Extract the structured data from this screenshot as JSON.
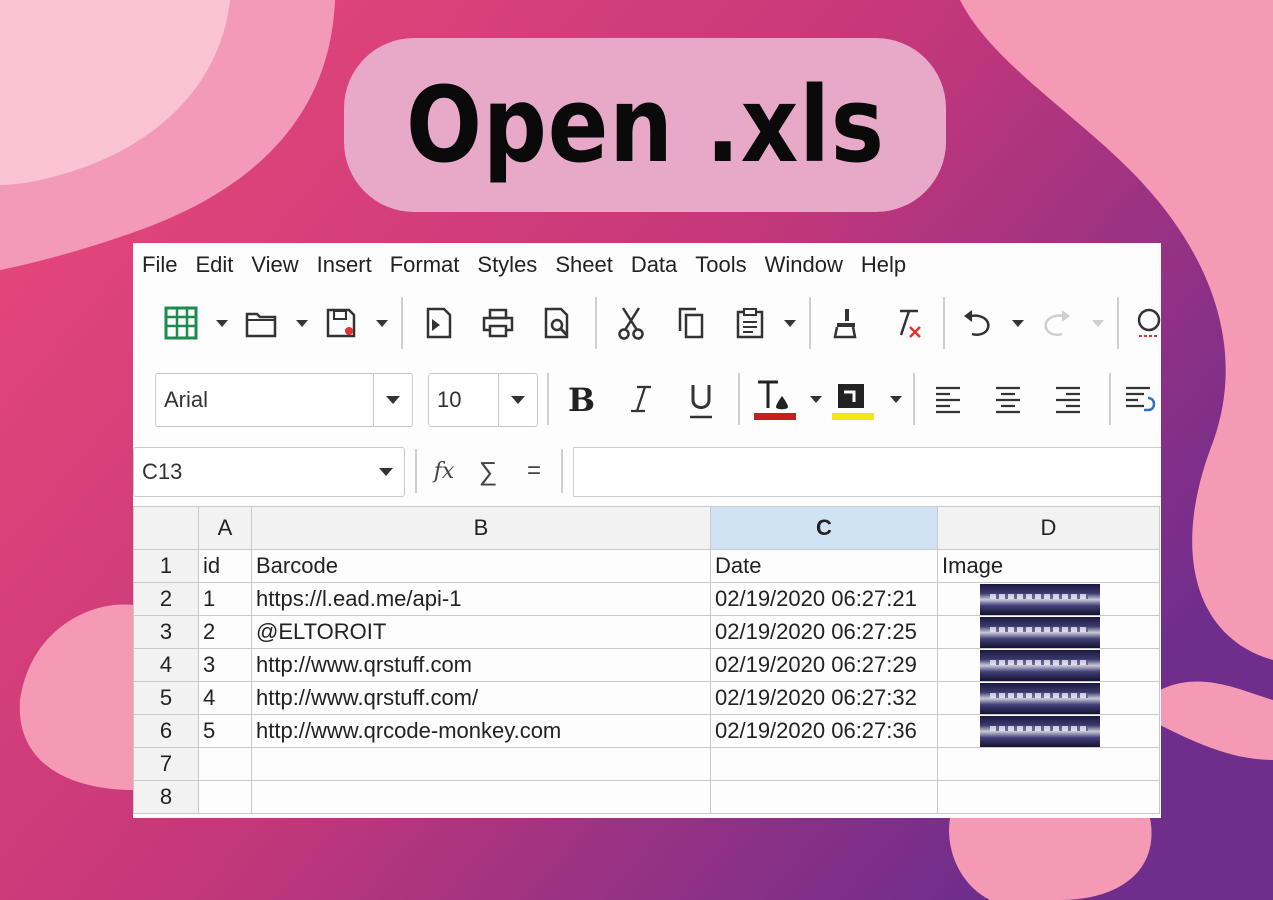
{
  "banner": {
    "title": "Open .xls"
  },
  "menu": [
    "File",
    "Edit",
    "View",
    "Insert",
    "Format",
    "Styles",
    "Sheet",
    "Data",
    "Tools",
    "Window",
    "Help"
  ],
  "toolbar": {
    "font_name": "Arial",
    "font_size": "10",
    "font_color": "#c81e1e",
    "highlight_color": "#f4e613",
    "icons": [
      "spreadsheet-icon",
      "open-folder-icon",
      "save-icon",
      "export-pdf-icon",
      "print-icon",
      "print-preview-icon",
      "cut-icon",
      "copy-icon",
      "paste-icon",
      "clone-formatting-icon",
      "clear-formatting-icon",
      "undo-icon",
      "redo-icon",
      "find-icon",
      "bold-icon",
      "italic-icon",
      "underline-icon",
      "font-color-icon",
      "highlight-color-icon",
      "align-left-icon",
      "align-center-icon",
      "align-right-icon",
      "wrap-text-icon"
    ]
  },
  "formula_bar": {
    "cell_ref": "C13",
    "fx": "fx",
    "sum": "∑",
    "equals": "=",
    "value": ""
  },
  "sheet": {
    "columns": [
      "A",
      "B",
      "C",
      "D"
    ],
    "selected_column": "C",
    "rows": [
      {
        "n": "1",
        "a": "id",
        "b": "Barcode",
        "c": "Date",
        "d": "Image",
        "img": false
      },
      {
        "n": "2",
        "a": "1",
        "b": "https://l.ead.me/api-1",
        "c": "02/19/2020 06:27:21",
        "d": "",
        "img": true
      },
      {
        "n": "3",
        "a": "2",
        "b": "@ELTOROIT",
        "c": "02/19/2020 06:27:25",
        "d": "",
        "img": true
      },
      {
        "n": "4",
        "a": "3",
        "b": "http://www.qrstuff.com",
        "c": "02/19/2020 06:27:29",
        "d": "",
        "img": true
      },
      {
        "n": "5",
        "a": "4",
        "b": "http://www.qrstuff.com/",
        "c": "02/19/2020 06:27:32",
        "d": "",
        "img": true
      },
      {
        "n": "6",
        "a": "5",
        "b": "http://www.qrcode-monkey.com",
        "c": "02/19/2020 06:27:36",
        "d": "",
        "img": true
      },
      {
        "n": "7",
        "a": "",
        "b": "",
        "c": "",
        "d": "",
        "img": false
      },
      {
        "n": "8",
        "a": "",
        "b": "",
        "c": "",
        "d": "",
        "img": false
      }
    ]
  }
}
